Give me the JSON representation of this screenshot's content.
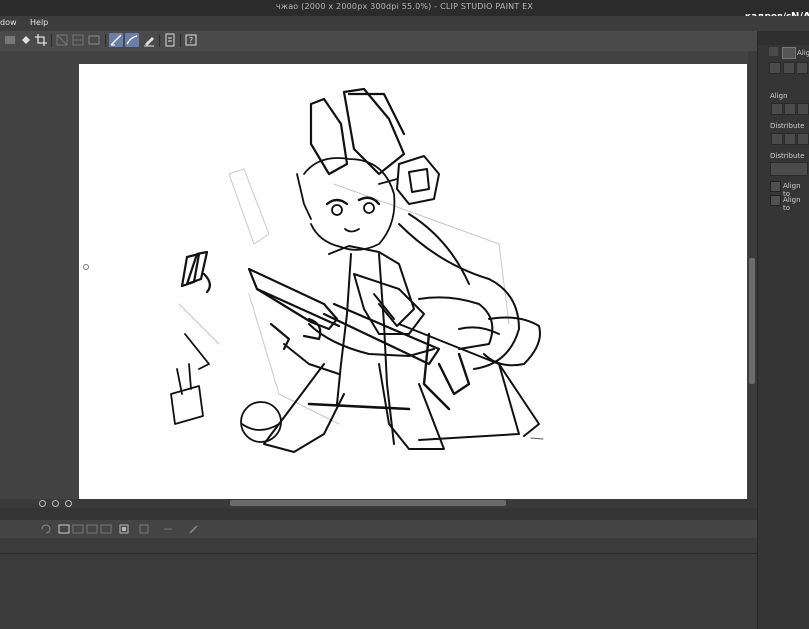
{
  "window": {
    "title": "чжао (2000 x 2000px 300dpi 55.0%)  - CLIP STUDIO PAINT EX"
  },
  "overlay": {
    "fps_label": "кадров/с",
    "fps_value": "N/A"
  },
  "menu": {
    "items": [
      "dow",
      "Help"
    ]
  },
  "toolbar": {
    "icons": [
      "layer-icon",
      "fill-icon",
      "crop-icon",
      "grid-icon",
      "ruler-icon",
      "frame-icon",
      "stabilizer-icon",
      "vector-snap-icon",
      "pen-pressure-icon",
      "file-icon",
      "help-icon"
    ],
    "active": [
      "stabilizer-icon",
      "vector-snap-icon"
    ]
  },
  "right_panel": {
    "tab_label": "Alig",
    "align_label": "Align",
    "distribute_label": "Distribute",
    "distribute_evenly_label": "Distribute ev",
    "align_to_1": "Align to",
    "align_to_2": "Align to"
  },
  "colors": {
    "accent": "#6a7fa8",
    "canvas_bg": "#434343",
    "paper": "#ffffff"
  }
}
